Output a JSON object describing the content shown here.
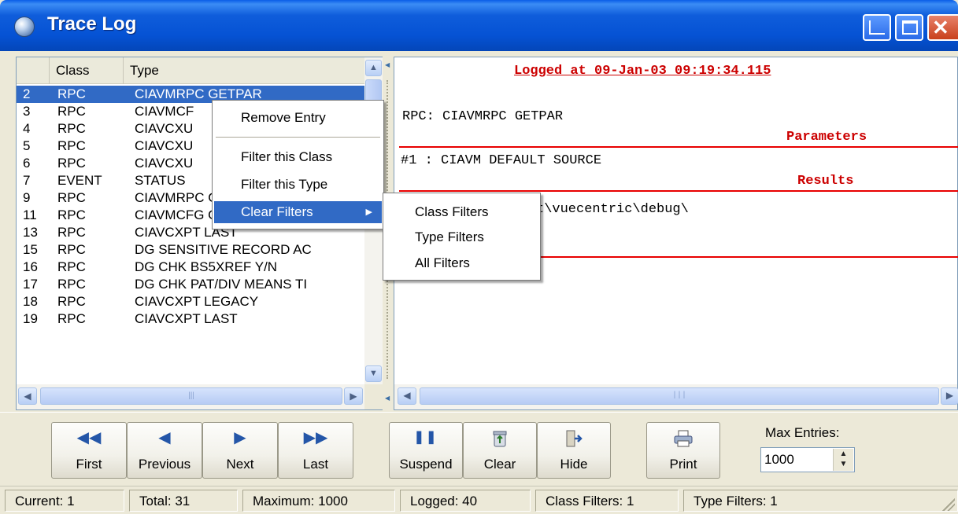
{
  "window": {
    "title": "Trace Log",
    "app_icon": "globe-icon",
    "controls": [
      "minimize-icon",
      "maximize-icon",
      "close-icon"
    ]
  },
  "list": {
    "headers": {
      "num": "",
      "class": "Class",
      "type": "Type"
    },
    "rows": [
      {
        "num": "2",
        "class": "RPC",
        "type": "CIAVMRPC GETPAR",
        "selected": true
      },
      {
        "num": "3",
        "class": "RPC",
        "type": "CIAVMCF"
      },
      {
        "num": "4",
        "class": "RPC",
        "type": "CIAVCXU"
      },
      {
        "num": "5",
        "class": "RPC",
        "type": "CIAVCXU"
      },
      {
        "num": "6",
        "class": "RPC",
        "type": "CIAVCXU"
      },
      {
        "num": "7",
        "class": "EVENT",
        "type": "STATUS"
      },
      {
        "num": "9",
        "class": "RPC",
        "type": "CIAVMRPC GETIDX"
      },
      {
        "num": "11",
        "class": "RPC",
        "type": "CIAVMCFG GETTEMPL"
      },
      {
        "num": "13",
        "class": "RPC",
        "type": "CIAVCXPT LAST"
      },
      {
        "num": "15",
        "class": "RPC",
        "type": "DG SENSITIVE RECORD AC"
      },
      {
        "num": "16",
        "class": "RPC",
        "type": "DG CHK BS5XREF Y/N"
      },
      {
        "num": "17",
        "class": "RPC",
        "type": "DG CHK PAT/DIV MEANS TI"
      },
      {
        "num": "18",
        "class": "RPC",
        "type": "CIAVCXPT LEGACY"
      },
      {
        "num": "19",
        "class": "RPC",
        "type": "CIAVCXPT LAST"
      }
    ]
  },
  "detail": {
    "logged_at": "Logged at 09-Jan-03 09:19:34.115",
    "rpc": "RPC:  CIAVMRPC GETPAR",
    "parameters_label": "Parameters",
    "param1": "#1 : CIAVM DEFAULT SOURCE",
    "results_label": "Results",
    "result1": "t\\vuecentric\\debug\\"
  },
  "context_menu": {
    "items": [
      "Remove Entry",
      "Filter this Class",
      "Filter this Type",
      "Clear Filters"
    ],
    "highlighted": "Clear Filters",
    "submenu": [
      "Class Filters",
      "Type Filters",
      "All Filters"
    ]
  },
  "toolbar": {
    "buttons": [
      {
        "label": "First",
        "icon": "double-left-arrow-icon"
      },
      {
        "label": "Previous",
        "icon": "left-arrow-icon"
      },
      {
        "label": "Next",
        "icon": "right-arrow-icon"
      },
      {
        "label": "Last",
        "icon": "double-right-arrow-icon"
      },
      {
        "label": "Suspend",
        "icon": "pause-icon"
      },
      {
        "label": "Clear",
        "icon": "recycle-bin-icon"
      },
      {
        "label": "Hide",
        "icon": "exit-door-icon"
      },
      {
        "label": "Print",
        "icon": "printer-icon"
      }
    ],
    "max_entries_label": "Max Entries:",
    "max_entries_value": "1000"
  },
  "status": {
    "current": "Current: 1",
    "total": "Total: 31",
    "maximum": "Maximum: 1000",
    "logged": "Logged: 40",
    "class_filters": "Class Filters: 1",
    "type_filters": "Type Filters: 1"
  },
  "colors": {
    "selection": "#316ac5",
    "accent_red": "#cc0000",
    "titlebar_blue": "#0552d4"
  }
}
